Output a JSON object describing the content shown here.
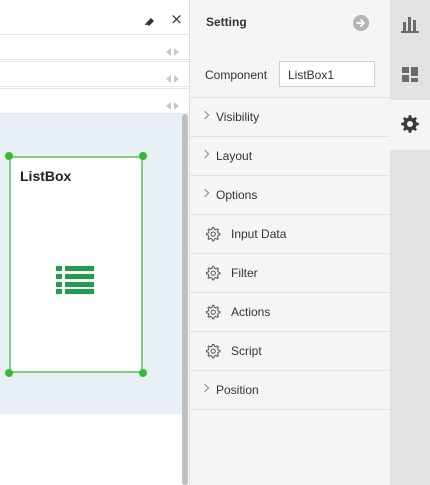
{
  "canvas": {
    "component_title": "ListBox",
    "component_icon": "list-icon"
  },
  "settings": {
    "title": "Setting",
    "component_label": "Component",
    "component_value": "ListBox1",
    "sections": [
      {
        "label": "Visibility",
        "icon": "chevron-right-icon"
      },
      {
        "label": "Layout",
        "icon": "chevron-right-icon"
      },
      {
        "label": "Options",
        "icon": "chevron-right-icon"
      },
      {
        "label": "Input Data",
        "icon": "gear-icon"
      },
      {
        "label": "Filter",
        "icon": "gear-icon"
      },
      {
        "label": "Actions",
        "icon": "gear-icon"
      },
      {
        "label": "Script",
        "icon": "gear-icon"
      },
      {
        "label": "Position",
        "icon": "chevron-right-icon"
      }
    ]
  },
  "rail": {
    "items": [
      "chart-icon",
      "dashboard-icon",
      "settings-gear-icon"
    ],
    "active": "settings-gear-icon"
  },
  "colors": {
    "selection_border": "#7fd07f",
    "handle": "#33bb33",
    "list_icon": "#1f9e4e",
    "canvas_bg": "#e8f0f5",
    "panel_bg": "#f5f5f5",
    "rail_bg": "#e2e2e2"
  }
}
